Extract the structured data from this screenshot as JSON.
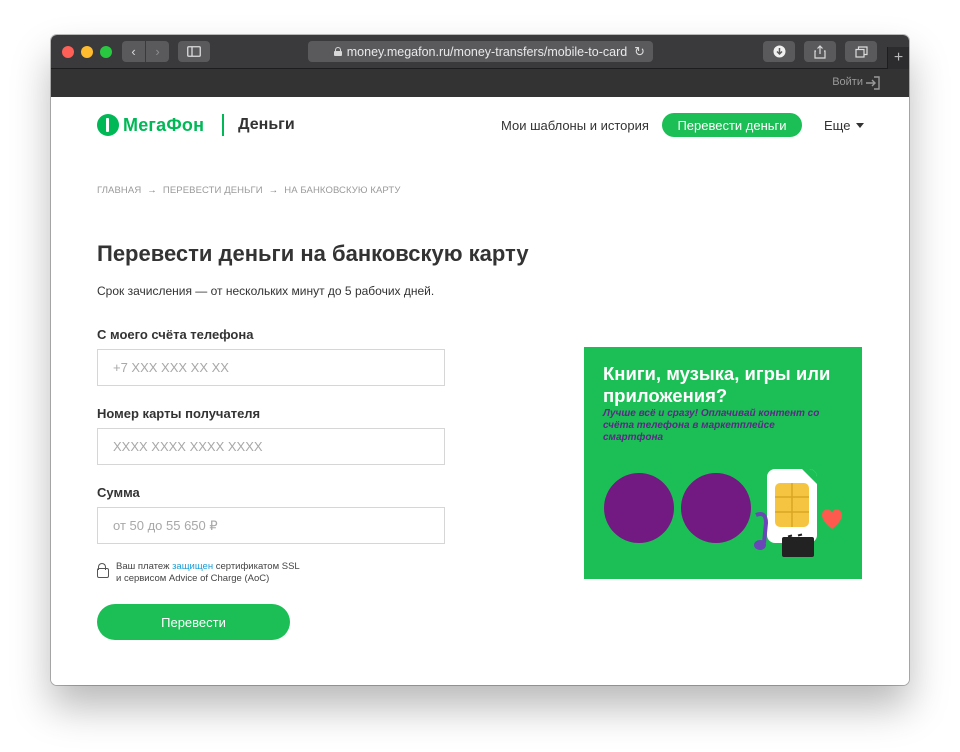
{
  "browser": {
    "url": "money.megafon.ru/money-transfers/mobile-to-card",
    "icons": [
      "back-icon",
      "forward-icon",
      "sidebar-icon",
      "lock-icon",
      "reload-icon",
      "download-icon",
      "share-icon",
      "tabs-icon",
      "new-tab-icon"
    ]
  },
  "topbar": {
    "login_label": "Войти"
  },
  "header": {
    "logo_text": "МегаФон",
    "logo_sub": "Деньги",
    "nav_history": "Мои шаблоны и история",
    "nav_transfer": "Перевести деньги",
    "nav_more": "Еще"
  },
  "breadcrumb": {
    "items": [
      "ГЛАВНАЯ",
      "ПЕРЕВЕСТИ ДЕНЬГИ",
      "НА БАНКОВСКУЮ КАРТУ"
    ],
    "separator": "→"
  },
  "main": {
    "title": "Перевести деньги на банковскую карту",
    "subtitle": "Срок зачисления — от нескольких минут до 5 рабочих дней.",
    "fields": [
      {
        "label": "С моего счёта телефона",
        "placeholder": "+7 XXX XXX XX XX",
        "value": ""
      },
      {
        "label": "Номер карты получателя",
        "placeholder": "XXXX XXXX XXXX XXXX",
        "value": ""
      },
      {
        "label": "Сумма",
        "placeholder": "от 50 до 55 650 ₽",
        "value": ""
      }
    ],
    "secure_pre": "Ваш платеж ",
    "secure_link": "защищен",
    "secure_post": " сертификатом SSL",
    "secure_line2": "и сервисом Advice of Charge (AoC)",
    "submit_label": "Перевести"
  },
  "banner": {
    "title": "Книги, музыка, игры или приложения?",
    "text": "Лучше всё и сразу! Оплачивай контент со счёта телефона в маркетплейсе смартфона"
  },
  "colors": {
    "brand_green": "#1cbf55",
    "brand_purple": "#731982",
    "link_blue": "#1a9ed6"
  }
}
